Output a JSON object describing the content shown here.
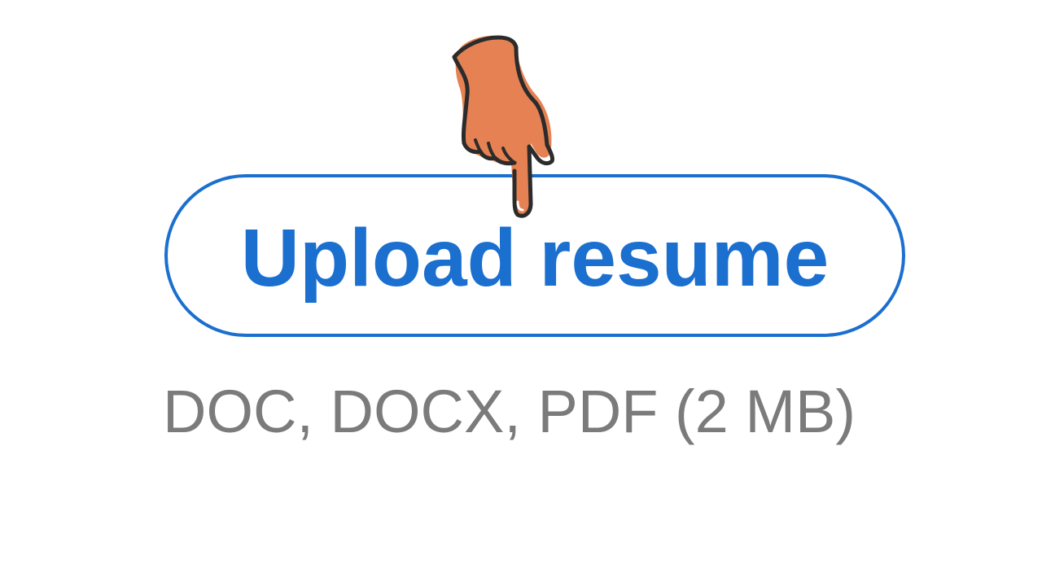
{
  "upload": {
    "button_label": "Upload resume",
    "hint": "DOC, DOCX, PDF (2 MB)"
  },
  "icons": {
    "pointer": "pointing-hand-icon"
  },
  "colors": {
    "accent": "#1a6fcf",
    "hint_text": "#7b7b7b",
    "hand_fill": "#e58152",
    "hand_outline": "#2b2b2b"
  }
}
